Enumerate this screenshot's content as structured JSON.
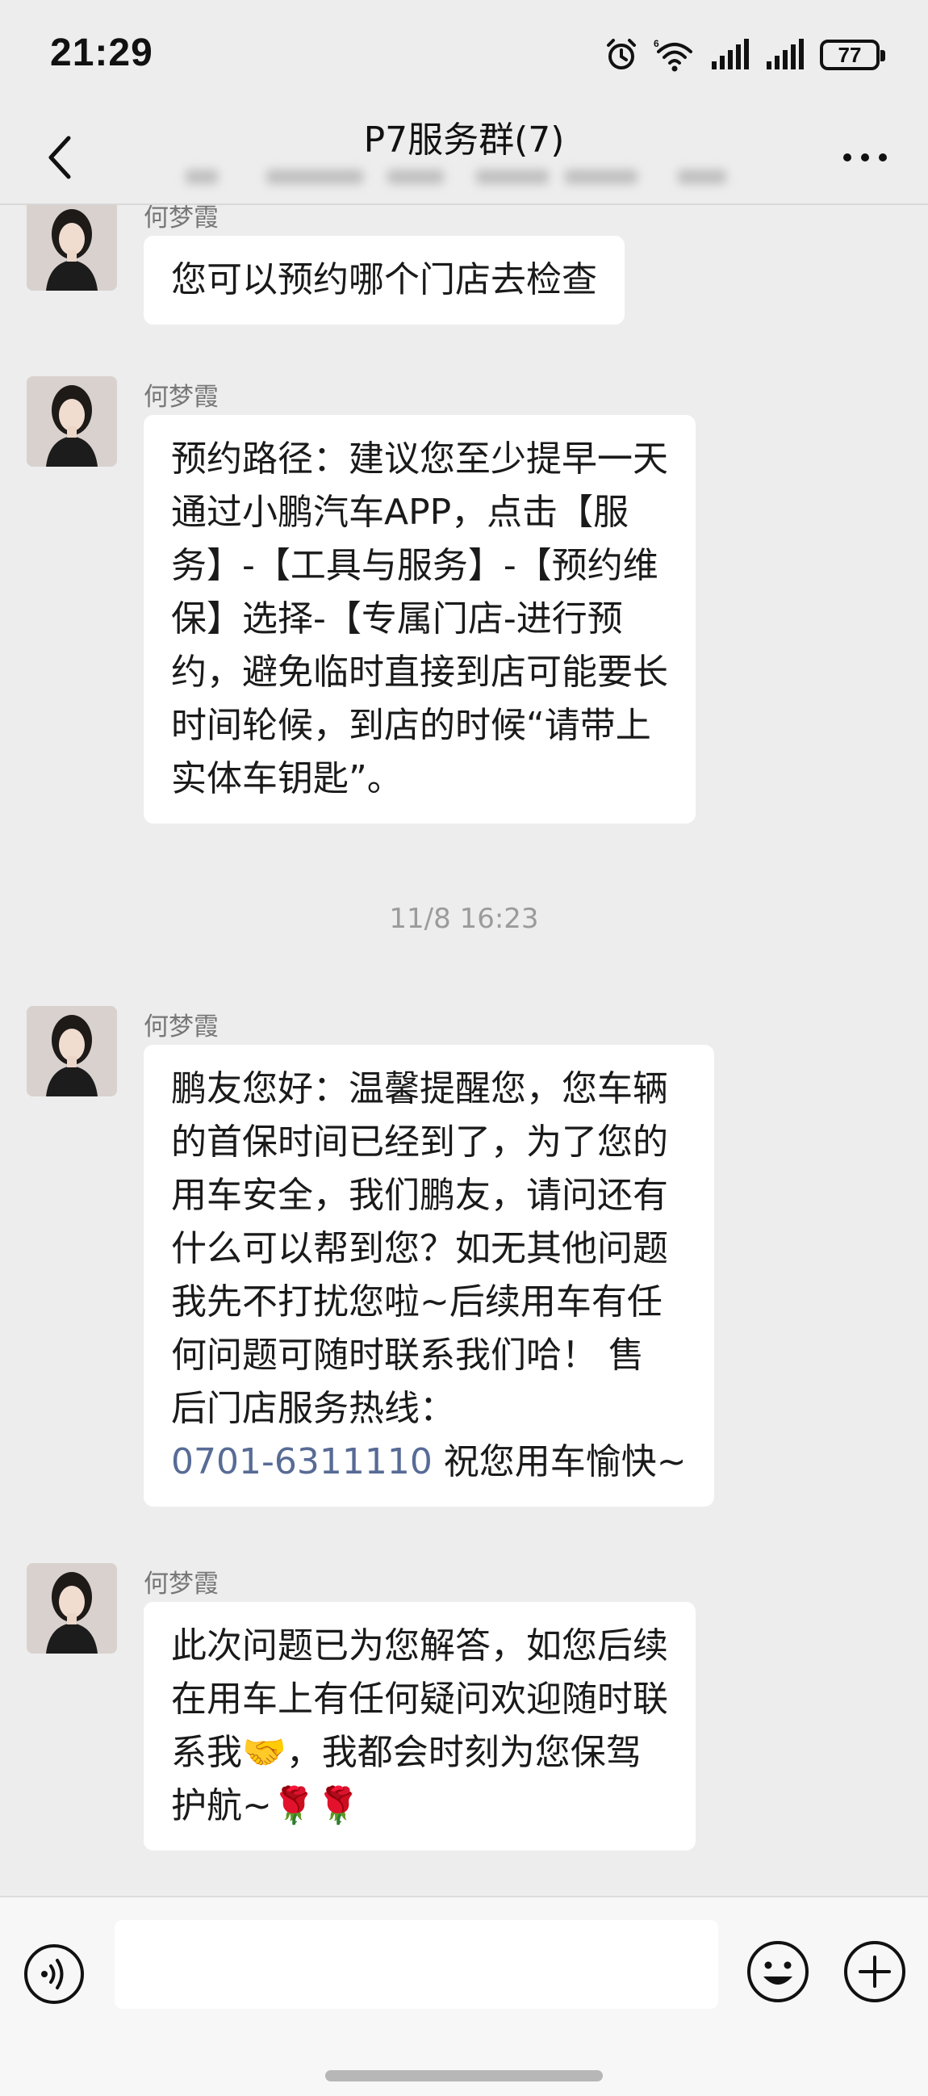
{
  "status_bar": {
    "time": "21:29",
    "battery": "77",
    "icons": [
      "alarm-icon",
      "wifi-6-icon",
      "signal-icon",
      "signal-icon",
      "battery-icon"
    ]
  },
  "header": {
    "title": "P7服务群(7)",
    "back_icon": "chevron-left-icon",
    "more_icon": "more-icon"
  },
  "messages": [
    {
      "sender": "何梦霞",
      "lines": [
        "您可以预约哪个门店去检查"
      ]
    },
    {
      "sender": "何梦霞",
      "lines": [
        "预约路径：建议您至少提早一天",
        "通过小鹏汽车APP，点击【服",
        "务】-【工具与服务】-【预约维",
        "保】选择-【专属门店-进行预",
        "约，避免临时直接到店可能要长",
        "时间轮候，到店的时候“请带上",
        "实体车钥匙”。"
      ]
    },
    {
      "timestamp": "11/8 16:23"
    },
    {
      "sender": "何梦霞",
      "lines": [
        "鹏友您好：温馨提醒您，您车辆",
        "的首保时间已经到了，为了您的",
        "用车安全，我们鹏友，请问还有",
        "什么可以帮到您？如无其他问题",
        "我先不打扰您啦~后续用车有任",
        "何问题可随时联系我们哈！ 售",
        "后门店服务热线："
      ],
      "phone": "0701-6311110",
      "phone_suffix": " 祝您用车愉快~"
    },
    {
      "sender": "何梦霞",
      "lines": [
        "此次问题已为您解答，如您后续",
        "在用车上有任何疑问欢迎随时联",
        "系我🤝，我都会时刻为您保驾",
        "护航~🌹🌹"
      ]
    }
  ],
  "input_bar": {
    "placeholder": "",
    "voice_icon": "voice-icon",
    "emoji_icon": "emoji-icon",
    "plus_icon": "plus-icon"
  },
  "colors": {
    "background": "#ededed",
    "bubble": "#ffffff",
    "link": "#576b95",
    "timestamp": "#9b9b9b"
  }
}
